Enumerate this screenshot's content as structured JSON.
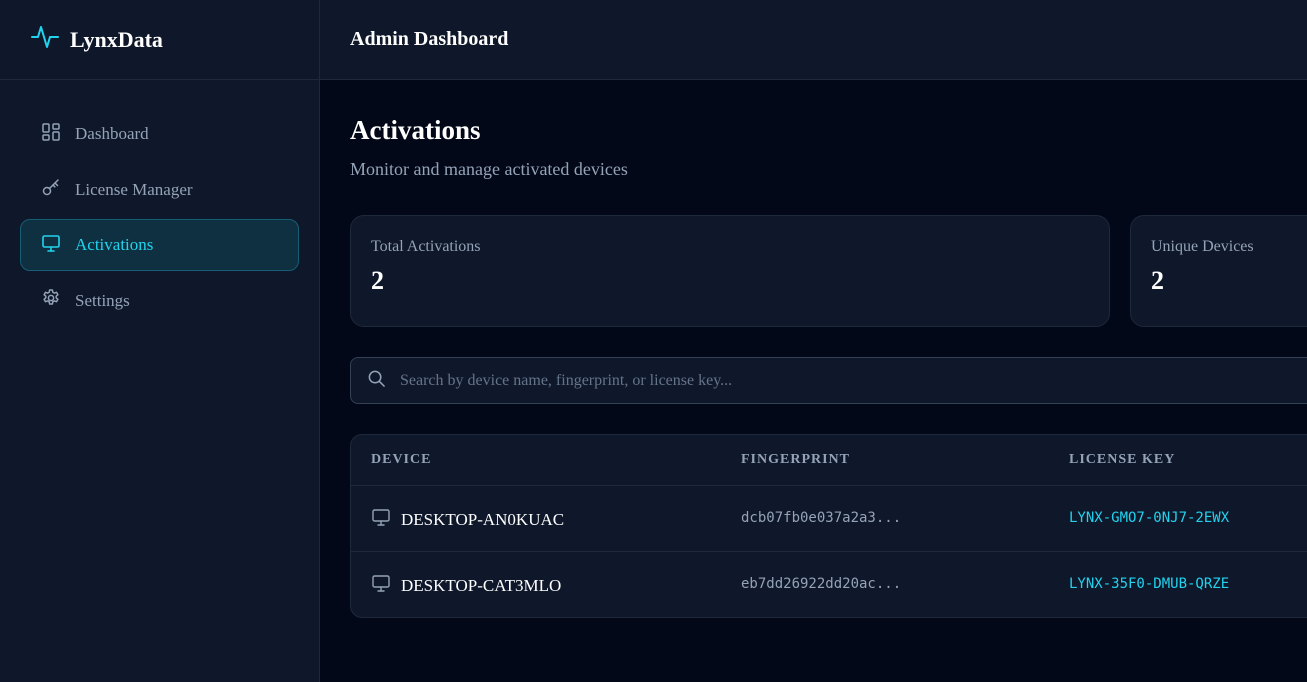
{
  "brand": {
    "name": "LynxData"
  },
  "sidebar": {
    "items": [
      {
        "label": "Dashboard",
        "icon": "dashboard-grid-icon",
        "active": false
      },
      {
        "label": "License Manager",
        "icon": "key-icon",
        "active": false
      },
      {
        "label": "Activations",
        "icon": "monitor-icon",
        "active": true
      },
      {
        "label": "Settings",
        "icon": "gear-icon",
        "active": false
      }
    ]
  },
  "header": {
    "title": "Admin Dashboard"
  },
  "page": {
    "title": "Activations",
    "subtitle": "Monitor and manage activated devices"
  },
  "stats": [
    {
      "label": "Total Activations",
      "value": "2"
    },
    {
      "label": "Unique Devices",
      "value": "2"
    }
  ],
  "search": {
    "placeholder": "Search by device name, fingerprint, or license key...",
    "value": ""
  },
  "table": {
    "columns": [
      "DEVICE",
      "FINGERPRINT",
      "LICENSE KEY"
    ],
    "rows": [
      {
        "device": "DESKTOP-AN0KUAC",
        "fingerprint": "dcb07fb0e037a2a3...",
        "license_key": "LYNX-GMO7-0NJ7-2EWX"
      },
      {
        "device": "DESKTOP-CAT3MLO",
        "fingerprint": "eb7dd26922dd20ac...",
        "license_key": "LYNX-35F0-DMUB-QRZE"
      }
    ]
  },
  "colors": {
    "accent": "#22d3ee",
    "background": "#020817",
    "panel": "#0f172a",
    "border": "#1e293b",
    "muted_text": "#94a3b8"
  }
}
